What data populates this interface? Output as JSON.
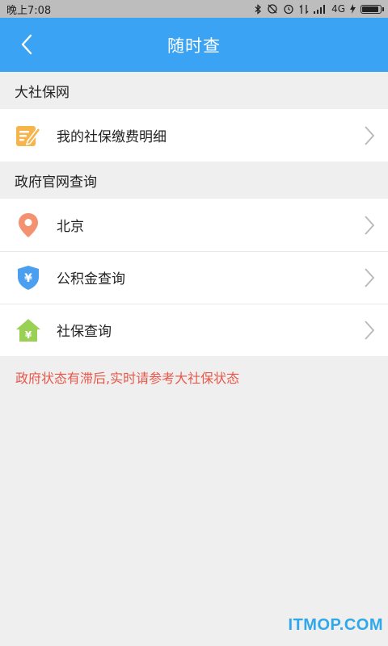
{
  "status_bar": {
    "time": "晚上7:08",
    "network": "4G"
  },
  "header": {
    "title": "随时查"
  },
  "sections": [
    {
      "title": "大社保网",
      "items": [
        {
          "label": "我的社保缴费明细",
          "icon": "edit-note-icon"
        }
      ]
    },
    {
      "title": "政府官网查询",
      "items": [
        {
          "label": "北京",
          "icon": "location-pin-icon"
        },
        {
          "label": "公积金查询",
          "icon": "yuan-shield-icon"
        },
        {
          "label": "社保查询",
          "icon": "yuan-house-icon"
        }
      ]
    }
  ],
  "notice": "政府状态有滞后,实时请参考大社保状态",
  "watermark": "ITMOP.COM",
  "colors": {
    "accent": "#3aa3f3",
    "notice": "#e8584a",
    "background": "#efefef",
    "icon_note": "#f6b44c",
    "icon_pin": "#f49270",
    "icon_shield": "#4a9ff0",
    "icon_house": "#9ad154"
  }
}
